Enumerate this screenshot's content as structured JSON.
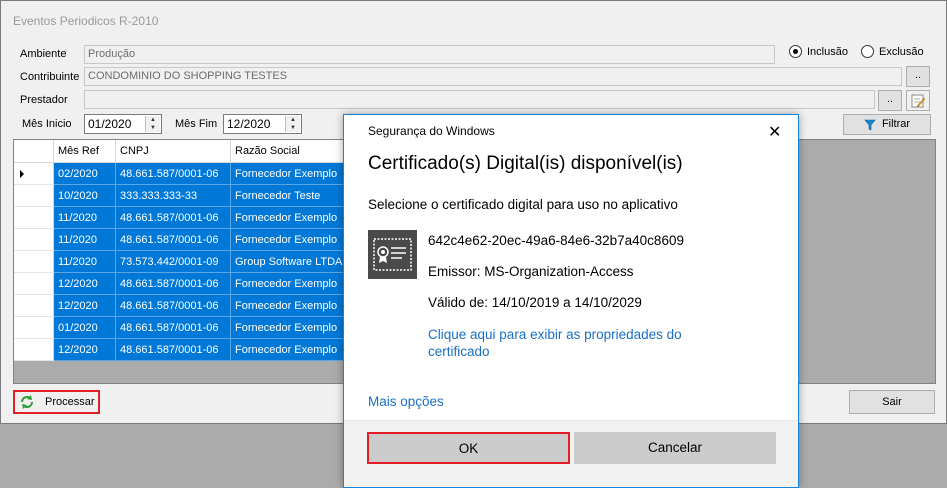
{
  "window": {
    "title": "Eventos Periodicos R-2010"
  },
  "form": {
    "ambiente_label": "Ambiente",
    "ambiente_value": "Produção",
    "contribuinte_label": "Contribuinte",
    "contribuinte_value": "CONDOMINIO DO SHOPPING TESTES",
    "prestador_label": "Prestador",
    "prestador_value": "",
    "browse_label": "..",
    "radio_inclusao": "Inclusão",
    "radio_exclusao": "Exclusão",
    "mes_inicio_label": "Mês Inicio",
    "mes_inicio_value": "01/2020",
    "mes_fim_label": "Mês Fim",
    "mes_fim_value": "12/2020",
    "filtrar_label": "Filtrar"
  },
  "grid": {
    "columns": [
      "Mês Ref",
      "CNPJ",
      "Razão Social"
    ],
    "rows": [
      [
        "02/2020",
        "48.661.587/0001-06",
        "Fornecedor Exemplo"
      ],
      [
        "10/2020",
        "333.333.333-33",
        "Fornecedor Teste"
      ],
      [
        "11/2020",
        "48.661.587/0001-06",
        "Fornecedor Exemplo"
      ],
      [
        "11/2020",
        "48.661.587/0001-06",
        "Fornecedor Exemplo"
      ],
      [
        "11/2020",
        "73.573.442/0001-09",
        "Group Software LTDA"
      ],
      [
        "12/2020",
        "48.661.587/0001-06",
        "Fornecedor Exemplo"
      ],
      [
        "12/2020",
        "48.661.587/0001-06",
        "Fornecedor Exemplo"
      ],
      [
        "01/2020",
        "48.661.587/0001-06",
        "Fornecedor Exemplo"
      ],
      [
        "12/2020",
        "48.661.587/0001-06",
        "Fornecedor Exemplo"
      ]
    ]
  },
  "footer": {
    "processar_label": "Processar",
    "sair_label": "Sair"
  },
  "dialog": {
    "subtitle": "Segurança do Windows",
    "close_glyph": "✕",
    "title": "Certificado(s) Digital(is) disponível(is)",
    "instruction": "Selecione o certificado digital para uso no aplicativo",
    "cert_id": "642c4e62-20ec-49a6-84e6-32b7a40c8609",
    "issuer": "Emissor: MS-Organization-Access",
    "validity": "Válido de: 14/10/2019 a 14/10/2029",
    "props_link_line1": "Clique aqui para exibir as propriedades do",
    "props_link_line2": "certificado",
    "more_options": "Mais opções",
    "ok_label": "OK",
    "cancel_label": "Cancelar"
  },
  "colors": {
    "selection": "#0078d7",
    "link": "#1a6fc4",
    "highlight_border": "#e21f26",
    "dialog_border": "#1883d7"
  },
  "icons": [
    "cert-icon",
    "refresh-icon",
    "filter-icon",
    "edit-icon",
    "close-icon",
    "row-pointer-icon"
  ]
}
